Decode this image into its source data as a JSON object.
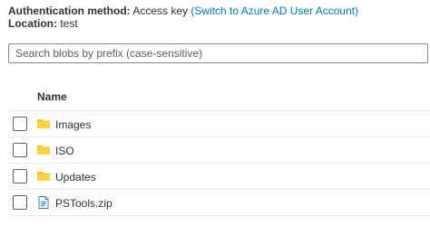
{
  "info": {
    "auth_label": "Authentication method:",
    "auth_value": "Access key",
    "auth_link": "(Switch to Azure AD User Account)",
    "location_label": "Location:",
    "location_value": "test"
  },
  "search": {
    "placeholder": "Search blobs by prefix (case-sensitive)",
    "value": ""
  },
  "table": {
    "columns": [
      "Name"
    ],
    "rows": [
      {
        "name": "Images",
        "icon": "folder-icon"
      },
      {
        "name": "ISO",
        "icon": "folder-icon"
      },
      {
        "name": "Updates",
        "icon": "folder-icon"
      },
      {
        "name": "PSTools.zip",
        "icon": "file-icon"
      }
    ]
  },
  "colors": {
    "link": "#0078d4",
    "folder": "#f2c811",
    "file_outline": "#2b88d8"
  }
}
